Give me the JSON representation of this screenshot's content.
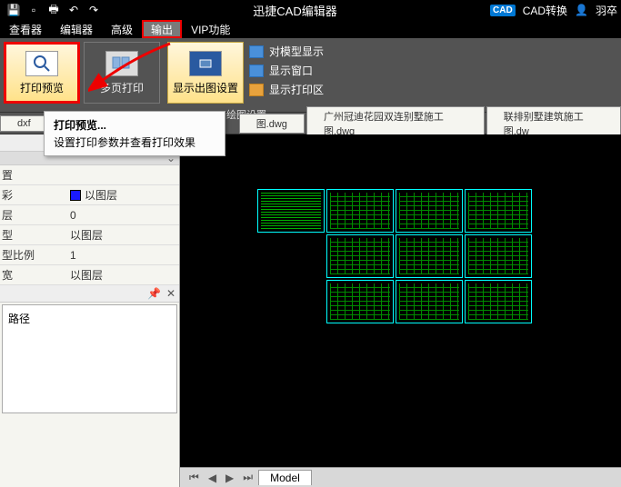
{
  "titlebar": {
    "app_title": "迅捷CAD编辑器",
    "cad_badge": "CAD",
    "convert_label": "CAD转换",
    "user_label": "羽卒"
  },
  "menubar": {
    "items": [
      "查看器",
      "编辑器",
      "高级",
      "输出",
      "VIP功能"
    ]
  },
  "ribbon": {
    "print_preview": "打印预览",
    "multi_print": "多页打印",
    "display_settings": "显示出图设置",
    "show_model": "对模型显示",
    "show_window": "显示窗口",
    "show_print_area": "显示打印区",
    "group_label": "绘图设置"
  },
  "tooltip": {
    "title": "打印预览...",
    "desc": "设置打印参数并查看打印效果"
  },
  "tabs": {
    "items": [
      "dxf",
      "图.dwg",
      "广州冠迪花园双连别墅施工图.dwg",
      "联排别墅建筑施工图.dw"
    ]
  },
  "properties": {
    "rows": [
      {
        "label": "置",
        "value": ""
      },
      {
        "label": "彩",
        "value": "以图层",
        "swatch": true
      },
      {
        "label": "层",
        "value": "0"
      },
      {
        "label": "型",
        "value": "以图层"
      },
      {
        "label": "型比例",
        "value": "1"
      },
      {
        "label": "宽",
        "value": "以图层"
      }
    ],
    "path_label": "路径"
  },
  "bottom": {
    "model_tab": "Model"
  }
}
